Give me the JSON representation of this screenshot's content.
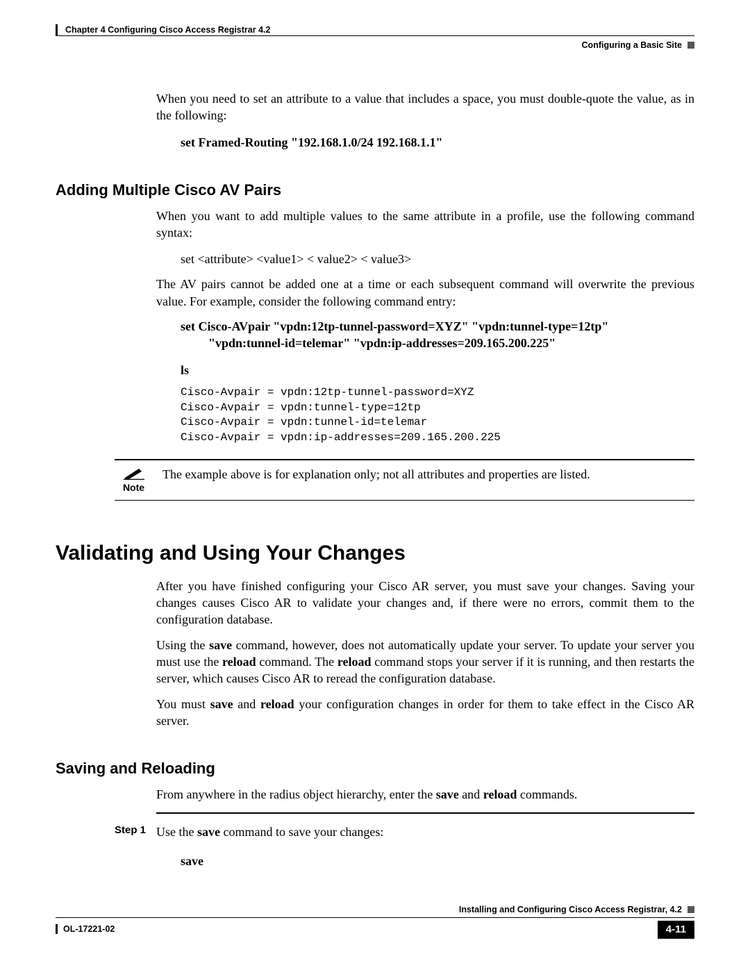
{
  "header": {
    "chapter": "Chapter 4      Configuring Cisco Access Registrar 4.2",
    "section": "Configuring a Basic Site"
  },
  "intro_para": "When you need to set an attribute to a value that includes a space, you must double-quote the value, as in the following:",
  "intro_cmd": "set Framed-Routing \"192.168.1.0/24  192.168.1.1\"",
  "sect1": {
    "title": "Adding Multiple Cisco AV Pairs",
    "p1": "When you want to add multiple values to the same attribute in a profile, use the following command syntax:",
    "cmd1": "set <attribute> <value1> < value2> < value3>",
    "p2": "The AV pairs cannot be added one at a time or each subsequent command will overwrite the previous value. For example, consider the following command entry:",
    "cmd2_l1": "set Cisco-AVpair \"vpdn:12tp-tunnel-password=XYZ\" \"vpdn:tunnel-type=12tp\"",
    "cmd2_l2": "\"vpdn:tunnel-id=telemar\" \"vpdn:ip-addresses=209.165.200.225\"",
    "ls": "ls",
    "output": "Cisco-Avpair = vpdn:12tp-tunnel-password=XYZ\nCisco-Avpair = vpdn:tunnel-type=12tp\nCisco-Avpair = vpdn:tunnel-id=telemar\nCisco-Avpair = vpdn:ip-addresses=209.165.200.225"
  },
  "note": {
    "label": "Note",
    "text": "The example above is for explanation only; not all attributes and properties are listed."
  },
  "sect2": {
    "title": "Validating and Using Your Changes",
    "p1": "After you have finished configuring your Cisco AR server, you must save your changes. Saving your changes causes Cisco AR to validate your changes and, if there were no errors, commit them to the configuration database.",
    "p2_pre": "Using the ",
    "p2_save": "save",
    "p2_mid1": " command, however, does not automatically update your server. To update your server you must use the ",
    "p2_reload": "reload",
    "p2_mid2": " command. The ",
    "p2_reload2": "reload",
    "p2_end": " command stops your server if it is running, and then restarts the server, which causes Cisco AR to reread the configuration database.",
    "p3_pre": "You must ",
    "p3_save": "save",
    "p3_mid": " and ",
    "p3_reload": "reload",
    "p3_end": " your configuration changes in order for them to take effect in the Cisco AR server."
  },
  "sect3": {
    "title": "Saving and Reloading",
    "p1_pre": "From anywhere in the radius object hierarchy, enter the ",
    "p1_save": "save",
    "p1_mid": " and ",
    "p1_reload": "reload",
    "p1_end": " commands."
  },
  "step1": {
    "label": "Step 1",
    "text_pre": "Use the ",
    "text_save": "save",
    "text_end": " command to save your changes:",
    "cmd": "save"
  },
  "footer": {
    "book": "Installing and Configuring Cisco Access Registrar, 4.2",
    "ol": "OL-17221-02",
    "page": "4-11"
  }
}
